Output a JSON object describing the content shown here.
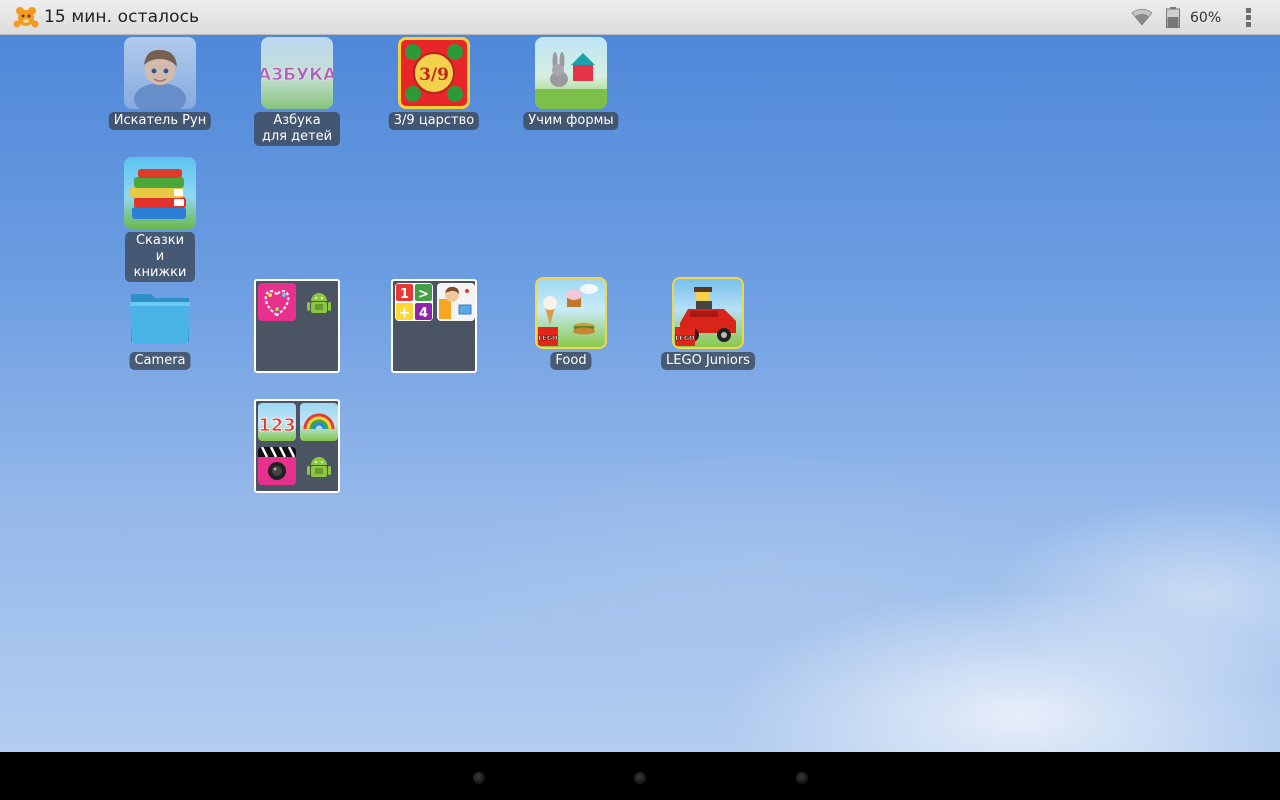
{
  "status_bar": {
    "time_left": "15 мин. осталось",
    "battery_percent": "60%",
    "battery_level": 0.6,
    "icons": [
      "bear-logo-icon",
      "wifi-icon",
      "battery-icon",
      "overflow-menu-icon"
    ]
  },
  "apps": {
    "rune_seeker": {
      "label": "Искатель Рун",
      "icon": "boy-portrait-icon"
    },
    "azbuka": {
      "label": "Азбука для детей",
      "icon_text": "АЗБУКА",
      "icon": "alphabet-icon"
    },
    "tsarstvo": {
      "label": "3/9 царство",
      "icon_text": "3/9",
      "icon": "dragon-kingdom-icon"
    },
    "shapes": {
      "label": "Учим формы",
      "icon": "bunny-shapes-icon"
    },
    "tales": {
      "label": "Сказки и книжки",
      "icon": "books-stack-icon"
    },
    "camera": {
      "label": "Camera",
      "icon": "folder-icon"
    },
    "food": {
      "label": "Food",
      "icon": "food-lego-icon",
      "badge": "LEGO"
    },
    "lego_juniors": {
      "label": "LEGO Juniors",
      "icon": "lego-car-icon",
      "badge": "LEGO"
    }
  },
  "folders": {
    "folder1": {
      "icons": [
        "hearts-game-icon",
        "android-icon"
      ]
    },
    "folder2": {
      "icons": [
        "math-game-icon",
        "teacher-game-icon"
      ],
      "math_text": [
        "1",
        ">",
        "+",
        "4"
      ]
    },
    "folder3": {
      "icons": [
        "numbers-123-icon",
        "rainbow-icon",
        "photo-clapper-icon",
        "android-icon"
      ],
      "numbers_text": "123"
    }
  },
  "nav_bar": {
    "buttons": [
      "back-button",
      "home-button",
      "recents-button"
    ]
  },
  "colors": {
    "status_bar": "#e4e4e4",
    "label_bg": "#3c4655",
    "folder_bg": "#4a5463",
    "wallpaper_top": "#4f88d9",
    "wallpaper_bottom": "#b3cdf0"
  }
}
